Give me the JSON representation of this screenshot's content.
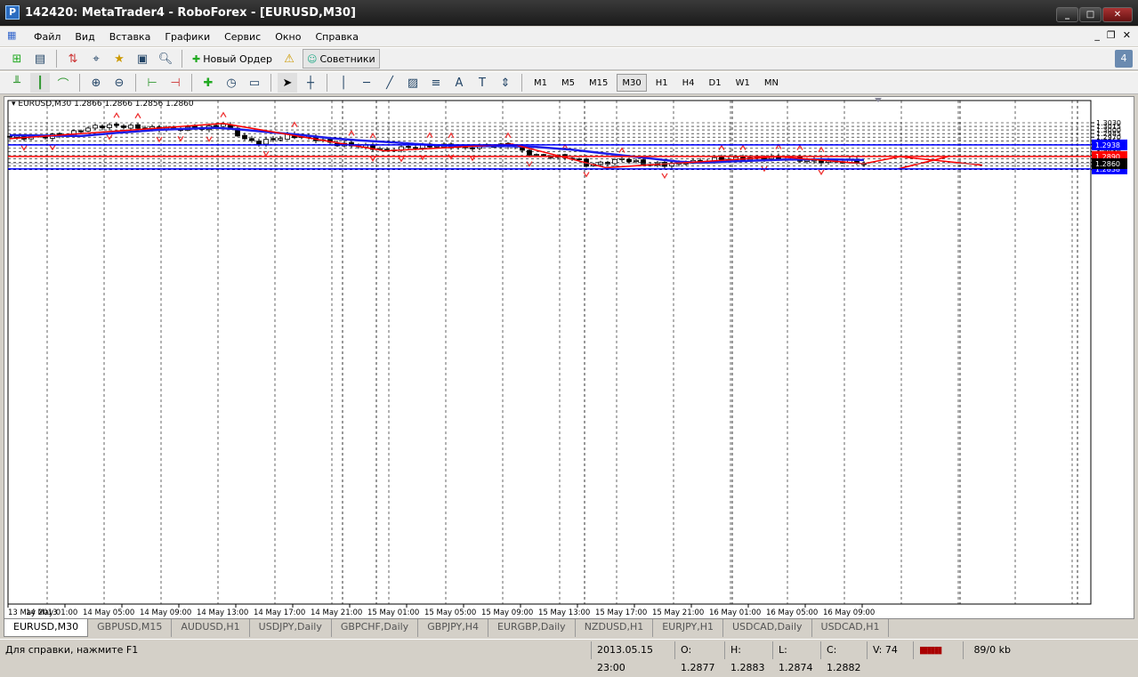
{
  "window": {
    "title": "142420: MetaTrader4 - RoboForex - [EURUSD,M30]",
    "logo": "P"
  },
  "menu": [
    "Файл",
    "Вид",
    "Вставка",
    "Графики",
    "Сервис",
    "Окно",
    "Справка"
  ],
  "toolbar": {
    "new_order": "Новый Ордер",
    "experts": "Советники",
    "timeframes": [
      "M1",
      "M5",
      "M15",
      "M30",
      "H1",
      "H4",
      "D1",
      "W1",
      "MN"
    ],
    "active_timeframe": "M30"
  },
  "notification_count": "4",
  "chart_data": {
    "type": "candlestick",
    "symbol_header": "EURUSD,M30  1.2866 1.2866 1.2856 1.2860",
    "ylim": [
      1.2832,
      1.3038
    ],
    "price_ticks": [
      "1.3030",
      "1.3015",
      "1.3000",
      "1.2985",
      "1.2970",
      "1.2955",
      "1.2940",
      "1.2925",
      "1.2910",
      "1.2895",
      "1.2880",
      "1.2865",
      "1.2850",
      "1.2835"
    ],
    "time_labels": [
      "13 May 2013",
      "14 May 01:00",
      "14 May 05:00",
      "14 May 09:00",
      "14 May 13:00",
      "14 May 17:00",
      "14 May 21:00",
      "15 May 01:00",
      "15 May 05:00",
      "15 May 09:00",
      "15 May 13:00",
      "15 May 17:00",
      "15 May 21:00",
      "16 May 01:00",
      "16 May 05:00",
      "16 May 09:00"
    ],
    "close_waypoints": [
      [
        0,
        1.297
      ],
      [
        3,
        1.2968
      ],
      [
        8,
        1.2982
      ],
      [
        12,
        1.3015
      ],
      [
        15,
        1.3018
      ],
      [
        19,
        1.3008
      ],
      [
        24,
        1.3005
      ],
      [
        28,
        1.301
      ],
      [
        30,
        1.3025
      ],
      [
        33,
        1.296
      ],
      [
        35,
        1.2948
      ],
      [
        39,
        1.2975
      ],
      [
        42,
        1.297
      ],
      [
        46,
        1.294
      ],
      [
        49,
        1.2935
      ],
      [
        53,
        1.2915
      ],
      [
        56,
        1.293
      ],
      [
        61,
        1.2935
      ],
      [
        64,
        1.2925
      ],
      [
        67,
        1.2935
      ],
      [
        71,
        1.2935
      ],
      [
        72,
        1.291
      ],
      [
        74,
        1.2895
      ],
      [
        79,
        1.2885
      ],
      [
        81,
        1.2855
      ],
      [
        84,
        1.2865
      ],
      [
        86,
        1.288
      ],
      [
        89,
        1.286
      ],
      [
        92,
        1.2855
      ],
      [
        96,
        1.2868
      ],
      [
        99,
        1.2878
      ],
      [
        102,
        1.288
      ],
      [
        107,
        1.2885
      ],
      [
        111,
        1.2875
      ],
      [
        116,
        1.2868
      ],
      [
        118,
        1.287
      ],
      [
        120,
        1.286
      ]
    ],
    "moving_average": [
      [
        0,
        1.2978
      ],
      [
        10,
        1.2975
      ],
      [
        15,
        1.2988
      ],
      [
        21,
        1.3001
      ],
      [
        29,
        1.3009
      ],
      [
        32,
        1.3003
      ],
      [
        36,
        1.2992
      ],
      [
        41,
        1.2979
      ],
      [
        45,
        1.2966
      ],
      [
        49,
        1.2957
      ],
      [
        54,
        1.2948
      ],
      [
        59,
        1.2938
      ],
      [
        64,
        1.2933
      ],
      [
        70,
        1.2933
      ],
      [
        74,
        1.2929
      ],
      [
        79,
        1.2918
      ],
      [
        84,
        1.2901
      ],
      [
        89,
        1.2885
      ],
      [
        94,
        1.2868
      ],
      [
        97,
        1.2864
      ],
      [
        102,
        1.287
      ],
      [
        109,
        1.2877
      ],
      [
        115,
        1.2878
      ],
      [
        120,
        1.2875
      ]
    ],
    "zigzag": [
      [
        0,
        1.2964
      ],
      [
        30,
        1.3027
      ],
      [
        52.75,
        1.2913
      ],
      [
        70.6,
        1.2941
      ],
      [
        83.75,
        1.2843
      ],
      [
        108,
        1.2889
      ],
      [
        120,
        1.286
      ]
    ],
    "projection_1": [
      [
        120,
        1.286
      ],
      [
        125,
        1.2889
      ],
      [
        136.6,
        1.2854
      ]
    ],
    "projection_2": [
      [
        124.75,
        1.2838
      ],
      [
        131.9,
        1.289
      ]
    ],
    "hlines": [
      {
        "price": 1.2938,
        "label": "1.2938",
        "color": "#0000ff"
      },
      {
        "price": 1.289,
        "label": "1.2890",
        "color": "#ff0000"
      },
      {
        "price": 1.2838,
        "label": "1.2838",
        "color": "#0000ff"
      }
    ],
    "current_price": {
      "price": 1.286,
      "label": "1.2860"
    }
  },
  "tabs": [
    "EURUSD,M30",
    "GBPUSD,M15",
    "AUDUSD,H1",
    "USDJPY,Daily",
    "GBPCHF,Daily",
    "GBPJPY,H4",
    "EURGBP,Daily",
    "NZDUSD,H1",
    "EURJPY,H1",
    "USDCAD,Daily",
    "USDCAD,H1"
  ],
  "status": {
    "help": "Для справки, нажмите F1",
    "time": "2013.05.15 23:00",
    "open": "O: 1.2877",
    "high": "H: 1.2883",
    "low": "L: 1.2874",
    "close": "C: 1.2882",
    "volume": "V: 74",
    "traffic": "89/0 kb"
  }
}
